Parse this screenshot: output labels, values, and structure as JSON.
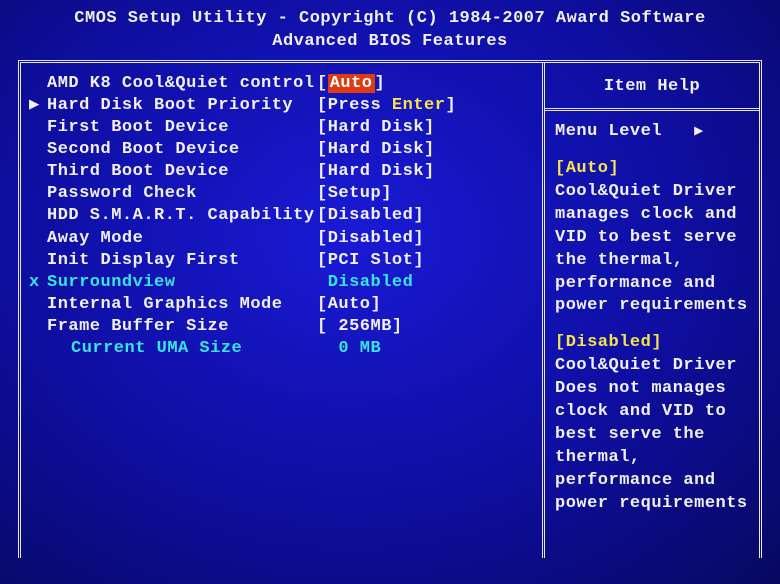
{
  "title_line1": "CMOS Setup Utility - Copyright (C) 1984-2007 Award Software",
  "title_line2": "Advanced BIOS Features",
  "rows": [
    {
      "marker": "",
      "label": "AMD K8 Cool&Quiet control",
      "lb": "[",
      "val": "Auto",
      "rb": "]",
      "sel": true
    },
    {
      "marker": "▶",
      "label": "Hard Disk Boot Priority",
      "lb": "[",
      "val": "Press ",
      "val2": "Enter",
      "rb": "]",
      "yl": true
    },
    {
      "marker": "",
      "label": "First Boot Device",
      "lb": "[",
      "val": "Hard Disk",
      "rb": "]"
    },
    {
      "marker": "",
      "label": "Second Boot Device",
      "lb": "[",
      "val": "Hard Disk",
      "rb": "]"
    },
    {
      "marker": "",
      "label": "Third Boot Device",
      "lb": "[",
      "val": "Hard Disk",
      "rb": "]"
    },
    {
      "marker": "",
      "label": "Password Check",
      "lb": "[",
      "val": "Setup",
      "rb": "]"
    },
    {
      "marker": "",
      "label": "HDD S.M.A.R.T. Capability",
      "lb": "[",
      "val": "Disabled",
      "rb": "]"
    },
    {
      "marker": "",
      "label": "Away Mode",
      "lb": "[",
      "val": "Disabled",
      "rb": "]"
    },
    {
      "marker": "",
      "label": "Init Display First",
      "lb": "[",
      "val": "PCI Slot",
      "rb": "]"
    },
    {
      "marker": "x",
      "label": "Surroundview",
      "lb": " ",
      "val": "Disabled",
      "rb": "",
      "cyan": true
    },
    {
      "marker": "",
      "label": "Internal Graphics Mode",
      "lb": "[",
      "val": "Auto",
      "rb": "]"
    },
    {
      "marker": "",
      "label": "Frame Buffer Size",
      "lb": "[",
      "val": " 256MB",
      "rb": "]"
    },
    {
      "marker": "",
      "label": "Current UMA Size",
      "lb": "  ",
      "val": "0 MB",
      "rb": "",
      "cyan": true,
      "indent": true
    }
  ],
  "help": {
    "title": "Item Help",
    "menu_level": "Menu Level",
    "p1_head": "[Auto]",
    "p1_body": "Cool&Quiet Driver manages clock and VID to best serve the thermal, performance and power  requirements",
    "p2_head": "[Disabled]",
    "p2_body": "Cool&Quiet Driver Does not manages clock and VID to best serve the thermal, performance and power requirements"
  }
}
